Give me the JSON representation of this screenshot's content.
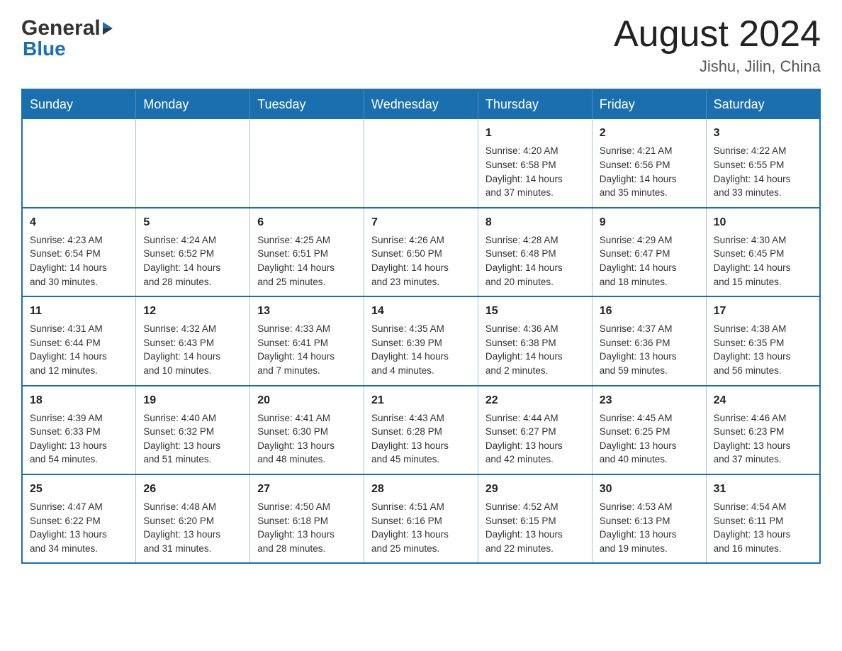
{
  "header": {
    "logo_general": "General",
    "logo_blue": "Blue",
    "month_title": "August 2024",
    "location": "Jishu, Jilin, China"
  },
  "days_of_week": [
    "Sunday",
    "Monday",
    "Tuesday",
    "Wednesday",
    "Thursday",
    "Friday",
    "Saturday"
  ],
  "weeks": [
    [
      {
        "num": "",
        "info": ""
      },
      {
        "num": "",
        "info": ""
      },
      {
        "num": "",
        "info": ""
      },
      {
        "num": "",
        "info": ""
      },
      {
        "num": "1",
        "info": "Sunrise: 4:20 AM\nSunset: 6:58 PM\nDaylight: 14 hours\nand 37 minutes."
      },
      {
        "num": "2",
        "info": "Sunrise: 4:21 AM\nSunset: 6:56 PM\nDaylight: 14 hours\nand 35 minutes."
      },
      {
        "num": "3",
        "info": "Sunrise: 4:22 AM\nSunset: 6:55 PM\nDaylight: 14 hours\nand 33 minutes."
      }
    ],
    [
      {
        "num": "4",
        "info": "Sunrise: 4:23 AM\nSunset: 6:54 PM\nDaylight: 14 hours\nand 30 minutes."
      },
      {
        "num": "5",
        "info": "Sunrise: 4:24 AM\nSunset: 6:52 PM\nDaylight: 14 hours\nand 28 minutes."
      },
      {
        "num": "6",
        "info": "Sunrise: 4:25 AM\nSunset: 6:51 PM\nDaylight: 14 hours\nand 25 minutes."
      },
      {
        "num": "7",
        "info": "Sunrise: 4:26 AM\nSunset: 6:50 PM\nDaylight: 14 hours\nand 23 minutes."
      },
      {
        "num": "8",
        "info": "Sunrise: 4:28 AM\nSunset: 6:48 PM\nDaylight: 14 hours\nand 20 minutes."
      },
      {
        "num": "9",
        "info": "Sunrise: 4:29 AM\nSunset: 6:47 PM\nDaylight: 14 hours\nand 18 minutes."
      },
      {
        "num": "10",
        "info": "Sunrise: 4:30 AM\nSunset: 6:45 PM\nDaylight: 14 hours\nand 15 minutes."
      }
    ],
    [
      {
        "num": "11",
        "info": "Sunrise: 4:31 AM\nSunset: 6:44 PM\nDaylight: 14 hours\nand 12 minutes."
      },
      {
        "num": "12",
        "info": "Sunrise: 4:32 AM\nSunset: 6:43 PM\nDaylight: 14 hours\nand 10 minutes."
      },
      {
        "num": "13",
        "info": "Sunrise: 4:33 AM\nSunset: 6:41 PM\nDaylight: 14 hours\nand 7 minutes."
      },
      {
        "num": "14",
        "info": "Sunrise: 4:35 AM\nSunset: 6:39 PM\nDaylight: 14 hours\nand 4 minutes."
      },
      {
        "num": "15",
        "info": "Sunrise: 4:36 AM\nSunset: 6:38 PM\nDaylight: 14 hours\nand 2 minutes."
      },
      {
        "num": "16",
        "info": "Sunrise: 4:37 AM\nSunset: 6:36 PM\nDaylight: 13 hours\nand 59 minutes."
      },
      {
        "num": "17",
        "info": "Sunrise: 4:38 AM\nSunset: 6:35 PM\nDaylight: 13 hours\nand 56 minutes."
      }
    ],
    [
      {
        "num": "18",
        "info": "Sunrise: 4:39 AM\nSunset: 6:33 PM\nDaylight: 13 hours\nand 54 minutes."
      },
      {
        "num": "19",
        "info": "Sunrise: 4:40 AM\nSunset: 6:32 PM\nDaylight: 13 hours\nand 51 minutes."
      },
      {
        "num": "20",
        "info": "Sunrise: 4:41 AM\nSunset: 6:30 PM\nDaylight: 13 hours\nand 48 minutes."
      },
      {
        "num": "21",
        "info": "Sunrise: 4:43 AM\nSunset: 6:28 PM\nDaylight: 13 hours\nand 45 minutes."
      },
      {
        "num": "22",
        "info": "Sunrise: 4:44 AM\nSunset: 6:27 PM\nDaylight: 13 hours\nand 42 minutes."
      },
      {
        "num": "23",
        "info": "Sunrise: 4:45 AM\nSunset: 6:25 PM\nDaylight: 13 hours\nand 40 minutes."
      },
      {
        "num": "24",
        "info": "Sunrise: 4:46 AM\nSunset: 6:23 PM\nDaylight: 13 hours\nand 37 minutes."
      }
    ],
    [
      {
        "num": "25",
        "info": "Sunrise: 4:47 AM\nSunset: 6:22 PM\nDaylight: 13 hours\nand 34 minutes."
      },
      {
        "num": "26",
        "info": "Sunrise: 4:48 AM\nSunset: 6:20 PM\nDaylight: 13 hours\nand 31 minutes."
      },
      {
        "num": "27",
        "info": "Sunrise: 4:50 AM\nSunset: 6:18 PM\nDaylight: 13 hours\nand 28 minutes."
      },
      {
        "num": "28",
        "info": "Sunrise: 4:51 AM\nSunset: 6:16 PM\nDaylight: 13 hours\nand 25 minutes."
      },
      {
        "num": "29",
        "info": "Sunrise: 4:52 AM\nSunset: 6:15 PM\nDaylight: 13 hours\nand 22 minutes."
      },
      {
        "num": "30",
        "info": "Sunrise: 4:53 AM\nSunset: 6:13 PM\nDaylight: 13 hours\nand 19 minutes."
      },
      {
        "num": "31",
        "info": "Sunrise: 4:54 AM\nSunset: 6:11 PM\nDaylight: 13 hours\nand 16 minutes."
      }
    ]
  ]
}
